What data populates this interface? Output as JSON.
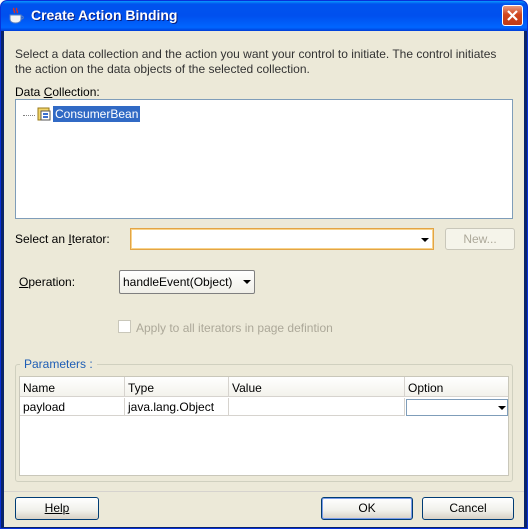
{
  "window": {
    "title": "Create Action Binding"
  },
  "description": "Select a data collection and the action you want your control to initiate. The control initiates the action on the data objects of the selected collection.",
  "data_collection": {
    "label": "Data Collection:",
    "label_mnemonic": "C",
    "items": [
      "ConsumerBean"
    ]
  },
  "iterator": {
    "label_pre": "Select an ",
    "label_mnemonic": "I",
    "label_post": "terator:",
    "value": "",
    "new_button": "New..."
  },
  "operation": {
    "label_mnemonic": "O",
    "label_post": "peration:",
    "value": "handleEvent(Object)"
  },
  "apply_all": {
    "label": "Apply to all iterators in page defintion",
    "checked": false,
    "enabled": false
  },
  "parameters": {
    "title": "Parameters :",
    "columns": [
      "Name",
      "Type",
      "Value",
      "Option"
    ],
    "rows": [
      {
        "name": "payload",
        "type": "java.lang.Object",
        "value": "",
        "option": ""
      }
    ]
  },
  "buttons": {
    "help": "Help",
    "ok": "OK",
    "cancel": "Cancel"
  },
  "colors": {
    "title_bar": "#0054e3",
    "selection": "#316ac5",
    "dialog_bg": "#ece9d8",
    "group_title": "#1e5eb5"
  }
}
